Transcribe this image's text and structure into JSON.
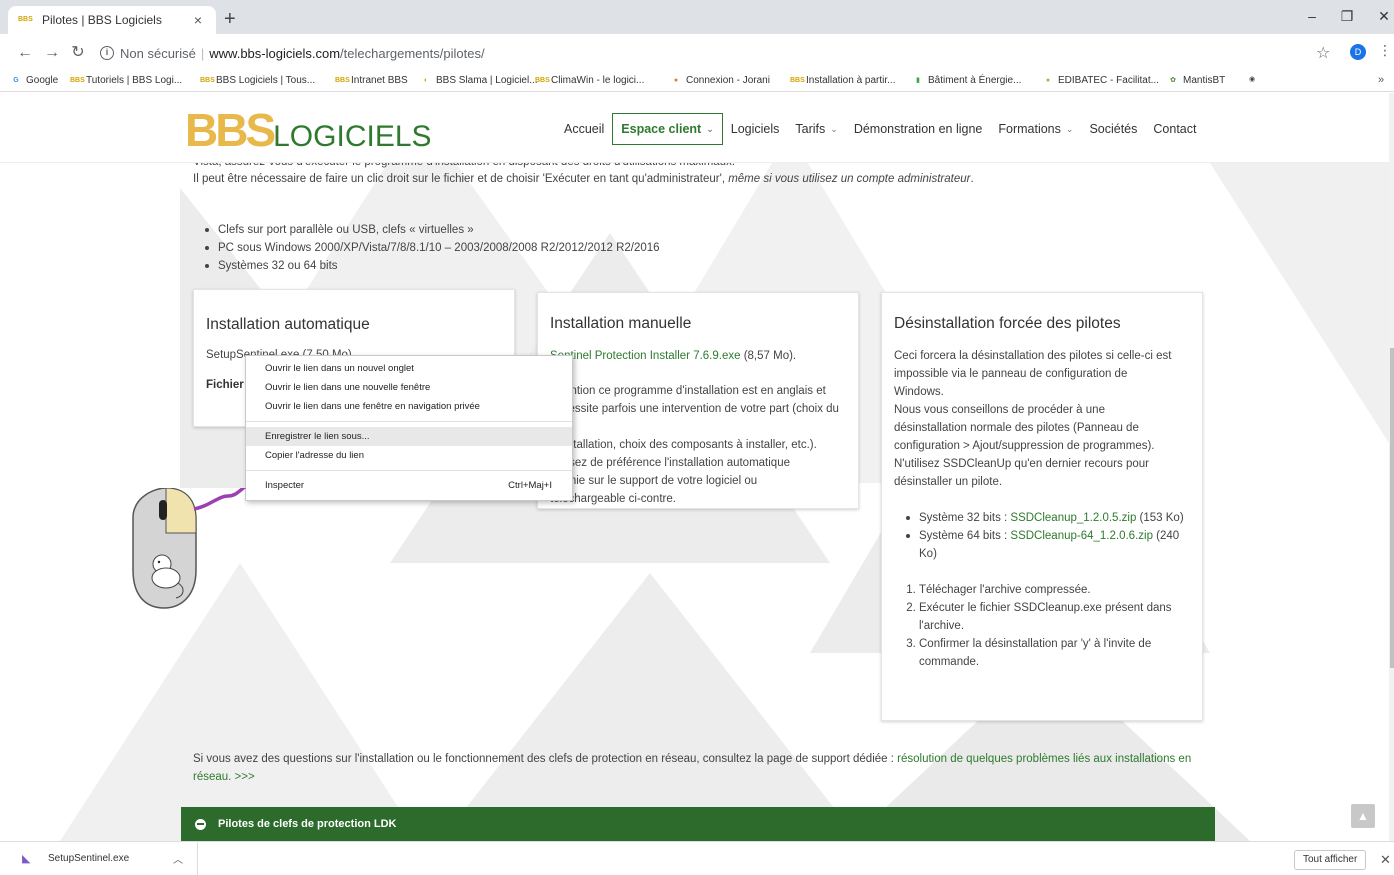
{
  "browser": {
    "tab_title": "Pilotes | BBS Logiciels",
    "tab_favicon": "BBS",
    "new_tab": "+",
    "address": {
      "security_label": "Non sécurisé",
      "separator": "|",
      "host": "www.bbs-logiciels.com",
      "path": "/telechargements/pilotes/"
    },
    "profile_initial": "D",
    "bookmarks": [
      {
        "label": "Google",
        "icon": "G",
        "color": "#4285f4"
      },
      {
        "label": "Tutoriels | BBS Logi...",
        "icon": "BBS",
        "color": "#d4a300"
      },
      {
        "label": "BBS Logiciels | Tous...",
        "icon": "BBS",
        "color": "#d4a300"
      },
      {
        "label": "Intranet BBS",
        "icon": "BBS",
        "color": "#d4a300"
      },
      {
        "label": "BBS Slama | Logiciel...",
        "icon": "◐",
        "color": "#d4a300"
      },
      {
        "label": "ClimaWin - le logici...",
        "icon": "BBS",
        "color": "#d4a300"
      },
      {
        "label": "Connexion - Jorani",
        "icon": "●",
        "color": "#e67e22"
      },
      {
        "label": "Installation à partir...",
        "icon": "BBS",
        "color": "#d4a300"
      },
      {
        "label": "Bâtiment à Énergie...",
        "icon": "▮",
        "color": "#3aa63a"
      },
      {
        "label": "EDIBATEC - Facilitat...",
        "icon": "●",
        "color": "#8bc34a"
      },
      {
        "label": "MantisBT",
        "icon": "✿",
        "color": "#4f8a2b"
      },
      {
        "label": "",
        "icon": "◉",
        "color": "#444"
      }
    ],
    "bookmarks_more": "»"
  },
  "site": {
    "logo_a": "BBS",
    "logo_b": "LOGICIELS",
    "nav": [
      {
        "label": "Accueil",
        "dropdown": false,
        "active": false
      },
      {
        "label": "Espace client",
        "dropdown": true,
        "active": true
      },
      {
        "label": "Logiciels",
        "dropdown": false,
        "active": false
      },
      {
        "label": "Tarifs",
        "dropdown": true,
        "active": false
      },
      {
        "label": "Démonstration en ligne",
        "dropdown": false,
        "active": false
      },
      {
        "label": "Formations",
        "dropdown": true,
        "active": false
      },
      {
        "label": "Sociétés",
        "dropdown": false,
        "active": false
      },
      {
        "label": "Contact",
        "dropdown": false,
        "active": false
      }
    ]
  },
  "content": {
    "intro_line1": "Vista, assurez-vous d'exécuter le programme d'installation en disposant des droits d'utilisations maximaux.",
    "intro_line2a": "Il peut être nécessaire de faire un clic droit sur le fichier et de choisir 'Exécuter en tant qu'administrateur',",
    "intro_line2b": " même si vous utilisez un compte administrateur",
    "intro_line2c": ".",
    "bullets": [
      "Clefs sur port parallèle ou USB, clefs « virtuelles »",
      "PC sous Windows 2000/XP/Vista/7/8/8.1/10 – 2003/2008/2008 R2/2012/2012 R2/2016",
      "Systèmes 32 ou 64 bits"
    ],
    "card_auto": {
      "title": "Installation automatique",
      "file": "SetupSentinel.exe (7,50 Mo)",
      "fichier_label": "Fichier"
    },
    "card_manual": {
      "title": "Installation manuelle",
      "link": "Sentinel Protection Installer 7.6.9.exe",
      "size": " (8,57 Mo).",
      "para": [
        "Attention ce programme d'installation est en anglais et",
        "nécessite parfois une intervention de votre part (choix du type",
        "d'installation, choix des composants à installer, etc.).",
        "Utilisez de préférence l'installation automatique",
        "fournie sur le support de votre logiciel ou",
        "téléchargeable ci-contre."
      ]
    },
    "card_uninstall": {
      "title": "Désinstallation forcée des pilotes",
      "para": [
        "Ceci forcera la désinstallation des pilotes si celle-ci est",
        "impossible via le panneau de configuration de",
        "Windows.",
        "Nous vous conseillons de procéder à une",
        "désinstallation normale des pilotes (Panneau de",
        "configuration > Ajout/suppression de programmes).",
        "N'utilisez SSDCleanUp qu'en dernier recours pour",
        "désinstaller un pilote."
      ],
      "downloads": [
        {
          "prefix": "Système 32 bits : ",
          "link": "SSDCleanup_1.2.0.5.zip",
          "suffix": " (153 Ko)"
        },
        {
          "prefix": "Système 64 bits : ",
          "link": "SSDCleanup-64_1.2.0.6.zip",
          "suffix": " (240 Ko)"
        }
      ],
      "steps": [
        "Téléchager l'archive compressée.",
        "Exécuter le fichier SSDCleanup.exe présent dans l'archive.",
        "Confirmer la désinstallation par 'y' à l'invite de commande."
      ]
    },
    "footer_text": "Si vous avez des questions sur l'installation ou le fonctionnement des clefs de protection en réseau, consultez la page de support dédiée : ",
    "footer_link": "résolution de quelques problèmes liés aux installations en réseau. >>>",
    "green_bar": "Pilotes de clefs de protection LDK",
    "totop": "▲"
  },
  "context_menu": [
    {
      "label": "Ouvrir le lien dans un nouvel onglet",
      "shortcut": ""
    },
    {
      "label": "Ouvrir le lien dans une nouvelle fenêtre",
      "shortcut": ""
    },
    {
      "label": "Ouvrir le lien dans une fenêtre en navigation privée",
      "shortcut": ""
    },
    {
      "label": "Enregistrer le lien sous...",
      "shortcut": ""
    },
    {
      "label": "Copier l'adresse du lien",
      "shortcut": ""
    },
    {
      "label": "Inspecter",
      "shortcut": "Ctrl+Maj+I"
    }
  ],
  "download_bar": {
    "file": "SetupSentinel.exe",
    "show_all": "Tout afficher"
  },
  "colors": {
    "brand_green": "#2f7a2f",
    "brand_gold": "#e8b84a",
    "bar_green": "#2c6b2c",
    "link_green": "#2f7a2f"
  }
}
